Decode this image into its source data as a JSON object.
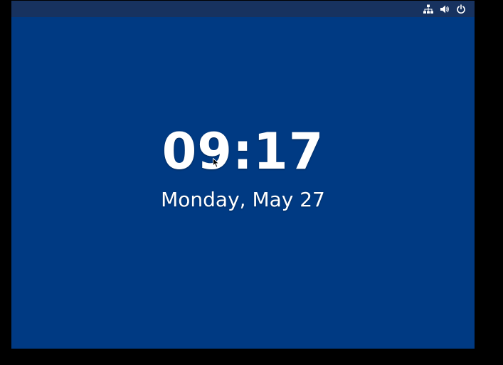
{
  "topbar": {
    "icons": [
      "network-icon",
      "volume-icon",
      "power-icon"
    ]
  },
  "lockscreen": {
    "time": "09:17",
    "date": "Monday, May 27"
  },
  "colors": {
    "background": "#003a83",
    "topbar": "#17325f",
    "outer": "#000000",
    "text": "#ffffff"
  }
}
